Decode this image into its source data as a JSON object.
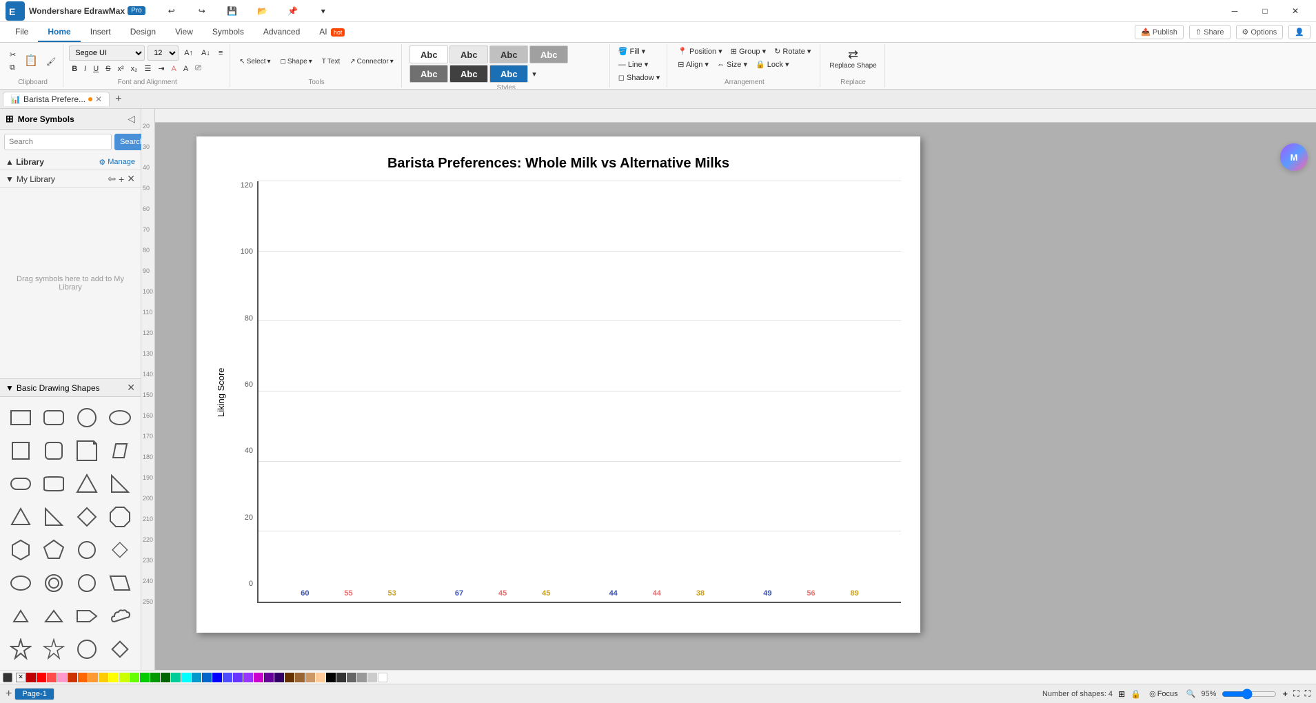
{
  "app": {
    "name": "Wondershare EdrawMax",
    "version": "Pro",
    "title": "Wondershare EdrawMax Pro"
  },
  "title_bar": {
    "undo_label": "↩",
    "redo_label": "↪",
    "save_label": "💾",
    "open_label": "📂",
    "pin_label": "📌",
    "share_label": "⇧",
    "options_label": "⚙"
  },
  "ribbon": {
    "tabs": [
      "File",
      "Home",
      "Insert",
      "Design",
      "View",
      "Symbols",
      "Advanced",
      "AI"
    ],
    "active_tab": "Home",
    "publish_label": "Publish",
    "share_label": "Share",
    "options_label": "Options"
  },
  "toolbar": {
    "clipboard": {
      "label": "Clipboard",
      "cut": "✂",
      "copy": "⧉",
      "paste": "📋",
      "format_painter": "🖌"
    },
    "font_family": "Segoe UI",
    "font_size": "12",
    "font_and_alignment": {
      "label": "Font and Alignment",
      "bold": "B",
      "italic": "I",
      "underline": "U",
      "strikethrough": "S",
      "superscript": "x²",
      "subscript": "x₂",
      "font_color": "A",
      "text_highlight": "A"
    },
    "tools": {
      "label": "Tools",
      "select": "Select",
      "shape": "Shape",
      "text": "Text",
      "connector": "Connector"
    },
    "styles": {
      "label": "Styles"
    },
    "fill": {
      "label": "Fill",
      "line": "Line",
      "shadow": "Shadow"
    },
    "arrangement": {
      "label": "Arrangement",
      "position": "Position",
      "group": "Group",
      "rotate": "Rotate",
      "align": "Align",
      "size": "Size",
      "lock": "Lock"
    },
    "replace": {
      "label": "Replace",
      "replace_shape": "Replace Shape"
    }
  },
  "doc_tab": {
    "name": "Barista Prefere...",
    "modified": true,
    "add_label": "+"
  },
  "sidebar": {
    "title": "More Symbols",
    "search_placeholder": "Search",
    "search_btn": "Search",
    "library_label": "Library",
    "manage_label": "Manage",
    "my_library_label": "My Library",
    "drag_drop_text": "Drag symbols here to add to My Library",
    "basic_shapes_label": "Basic Drawing Shapes"
  },
  "chart": {
    "title": "Barista Preferences: Whole Milk vs Alternative Milks",
    "y_axis_label": "Liking Score",
    "y_axis_ticks": [
      0,
      20,
      40,
      60,
      80,
      100,
      120
    ],
    "bar_groups": [
      {
        "label": "",
        "bars": [
          {
            "value": 60,
            "color": "#3a52b0",
            "label": "60"
          },
          {
            "value": 55,
            "color": "#e87070",
            "label": "55"
          },
          {
            "value": 53,
            "color": "#f0c040",
            "label": "53"
          }
        ]
      },
      {
        "label": "",
        "bars": [
          {
            "value": 67,
            "color": "#3a52b0",
            "label": "67"
          },
          {
            "value": 45,
            "color": "#e87070",
            "label": "45"
          },
          {
            "value": 45,
            "color": "#f0c040",
            "label": "45"
          }
        ]
      },
      {
        "label": "",
        "bars": [
          {
            "value": 44,
            "color": "#3a52b0",
            "label": "44"
          },
          {
            "value": 44,
            "color": "#e87070",
            "label": "44"
          },
          {
            "value": 38,
            "color": "#f0c040",
            "label": "38"
          }
        ]
      },
      {
        "label": "",
        "bars": [
          {
            "value": 49,
            "color": "#3a52b0",
            "label": "49"
          },
          {
            "value": 56,
            "color": "#e87070",
            "label": "56"
          },
          {
            "value": 89,
            "color": "#f0c040",
            "label": "89"
          }
        ]
      }
    ],
    "max_value": 120
  },
  "bottom_bar": {
    "page_label": "Page-1",
    "page_tab_label": "Page-1",
    "shapes_count": "Number of shapes: 4",
    "focus_label": "Focus",
    "zoom_level": "95%"
  },
  "palette_colors": [
    "#c00000",
    "#ff0000",
    "#ff4d4d",
    "#ff8080",
    "#ffb3b3",
    "#ff6600",
    "#ff9933",
    "#ffcc66",
    "#ffff00",
    "#ccff00",
    "#00cc00",
    "#009900",
    "#006600",
    "#00ffff",
    "#0099cc",
    "#0066cc",
    "#0000ff",
    "#4d4dff",
    "#9933ff",
    "#cc00cc",
    "#660099",
    "#330066",
    "#000000",
    "#333333",
    "#666666",
    "#999999",
    "#cccccc",
    "#ffffff",
    "#ff99cc",
    "#ff66aa",
    "#cc3399",
    "#993366",
    "#ffccff",
    "#cc99ff",
    "#9966ff",
    "#6633ff",
    "#00ccff",
    "#0099ff",
    "#0066ff",
    "#003399",
    "#00ffcc",
    "#00cc99",
    "#009966",
    "#006633",
    "#ccff99",
    "#99ff66",
    "#66ff33",
    "#33ff00",
    "#ffff99",
    "#ffff66"
  ],
  "group_label": "Group -"
}
